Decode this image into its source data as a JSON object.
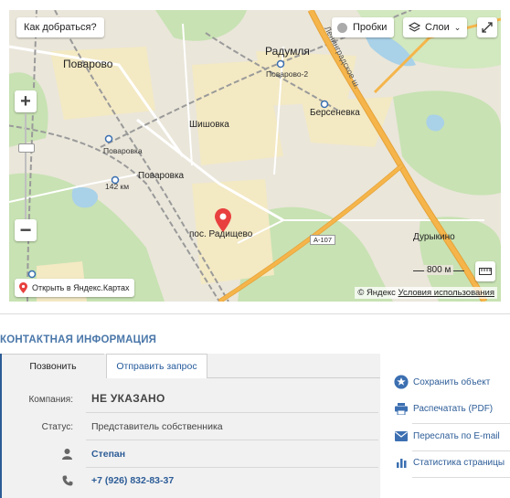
{
  "map": {
    "route_button": "Как добраться?",
    "traffic_button": "Пробки",
    "layers_button": "Слои",
    "zoom_in": "+",
    "zoom_out": "−",
    "open_in_maps": "Открыть в Яндекс.Картах",
    "scale": "800 м",
    "copyright_brand": "© Яндекс",
    "copyright_terms": "Условия использования",
    "road_badge": "А-107",
    "places": {
      "povarovo": "Поварово",
      "radumlya": "Радумля",
      "povarovo2": "Поварово-2",
      "bersenevka": "Берсеневка",
      "shishovka": "Шишовка",
      "povarovka_st": "Поваровка",
      "km142": "142 км",
      "povarovka": "Поваровка",
      "radishchevo": "пос. Радищево",
      "durykino": "Дурыкино",
      "leningrad_hwy": "Ленинградское ш."
    },
    "colors": {
      "water": "#a9d1e8",
      "forest": "#c8e2b3",
      "road": "#f5b54a",
      "settlement": "#f3e9c3"
    }
  },
  "contact": {
    "title": "КОНТАКТНАЯ ИНФОРМАЦИЯ",
    "tabs": [
      "Позвонить",
      "Отправить запрос"
    ],
    "company_label": "Компания:",
    "company_value": "НЕ УКАЗАНО",
    "status_label": "Статус:",
    "status_value": "Представитель собственника",
    "person_name": "Степан",
    "phone": "+7 (926) 832-83-37"
  },
  "actions": {
    "save": "Сохранить объект",
    "print": "Распечатать (PDF)",
    "email": "Переслать по E-mail",
    "stats": "Статистика страницы"
  }
}
